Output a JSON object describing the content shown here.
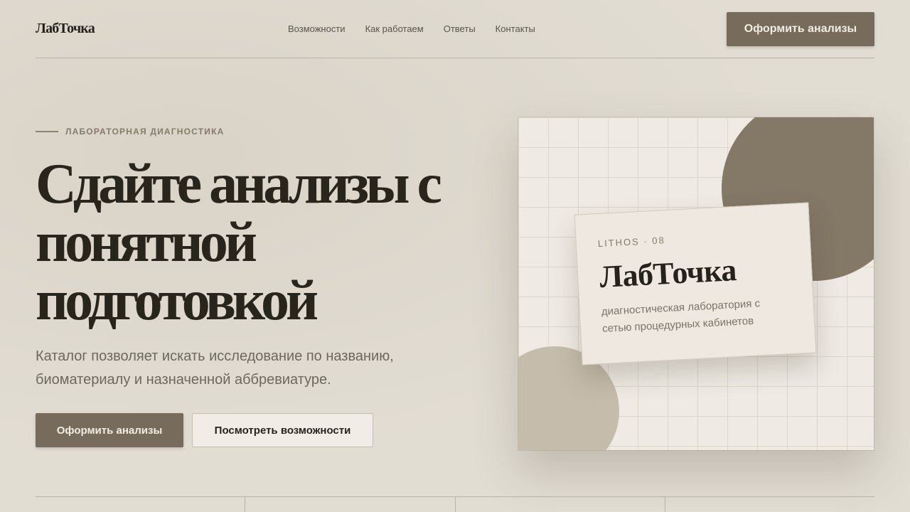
{
  "header": {
    "logo": "ЛабТочка",
    "nav": [
      "Возможности",
      "Как работаем",
      "Ответы",
      "Контакты"
    ],
    "cta": "Оформить анализы"
  },
  "hero": {
    "eyebrow": "ЛАБОРАТОРНАЯ ДИАГНОСТИКА",
    "title": "Сдайте анализы с понятной подготовкой",
    "description": "Каталог позволяет искать исследование по названию, биоматериалу и назначенной аббревиатуре.",
    "primary_button": "Оформить анализы",
    "secondary_button": "Посмотреть возможности"
  },
  "visual_card": {
    "code": "LITHOS · 08",
    "title": "ЛабТочка",
    "description": "диагностическая лаборатория с сетью процедурных кабинетов"
  },
  "colors": {
    "background": "#e2ddd3",
    "accent": "#776c5b",
    "text_dark": "#28251d"
  }
}
